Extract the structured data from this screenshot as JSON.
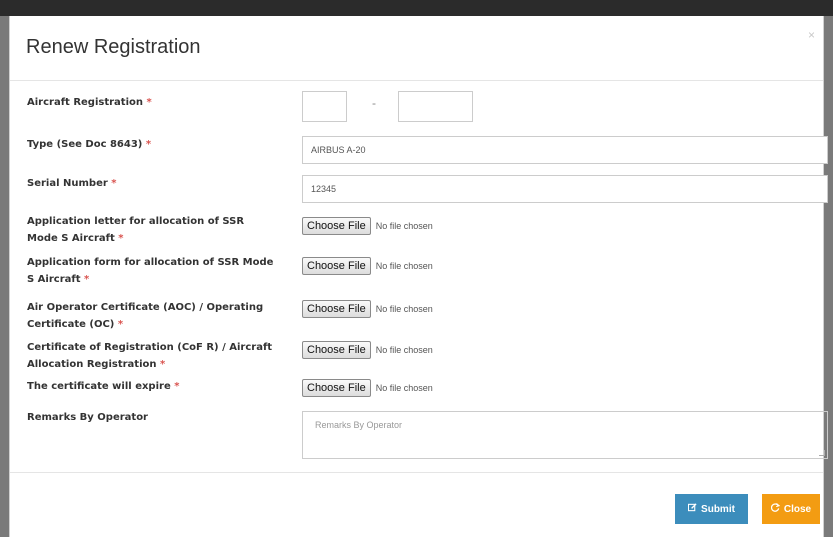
{
  "modal": {
    "title": "Renew Registration",
    "close_glyph": "×"
  },
  "form": {
    "required_mark": "*",
    "aircraft_registration": {
      "label": "Aircraft Registration",
      "separator": "-",
      "prefix_value": "",
      "suffix_value": ""
    },
    "type": {
      "label": "Type (See Doc 8643)",
      "value": "AIRBUS A-20"
    },
    "serial_number": {
      "label": "Serial Number",
      "value": "12345"
    },
    "file_fields": [
      {
        "label_line1": "Application letter for allocation of SSR",
        "label_line2": "Mode S Aircraft",
        "button": "Choose File",
        "status": "No file chosen"
      },
      {
        "label_line1": "Application form for allocation of SSR Mode",
        "label_line2": "S Aircraft",
        "button": "Choose File",
        "status": "No file chosen"
      },
      {
        "label_line1": "Air Operator Certificate (AOC) / Operating",
        "label_line2": "Certificate (OC)",
        "button": "Choose File",
        "status": "No file chosen"
      },
      {
        "label_line1": "Certificate of Registration (CoF R) / Aircraft",
        "label_line2": "Allocation Registration",
        "button": "Choose File",
        "status": "No file chosen"
      },
      {
        "label_line1": "The certificate will expire",
        "label_line2": "",
        "button": "Choose File",
        "status": "No file chosen"
      }
    ],
    "remarks": {
      "label": "Remarks By Operator",
      "placeholder": "Remarks By Operator"
    }
  },
  "footer": {
    "submit_label": "Submit",
    "close_label": "Close",
    "submit_icon": "edit-icon",
    "close_icon": "refresh-icon",
    "submit_color": "#3c8dbc",
    "close_color": "#f39c12"
  }
}
